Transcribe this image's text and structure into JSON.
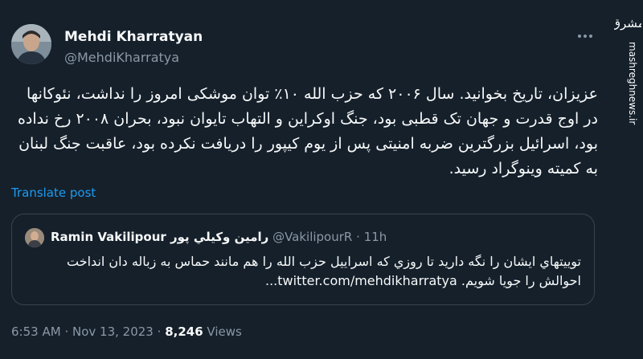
{
  "author": {
    "name": "Mehdi Kharratyan",
    "handle": "@MehdiKharratya"
  },
  "tweet": {
    "text": "عزیزان، تاریخ بخوانید. سال ۲۰۰۶ که حزب الله ۱۰٪ توان موشکی امروز را نداشت، نئوکانها در اوج قدرت و جهان تک قطبی بود، جنگ اوکراین و التهاب تایوان نبود، بحران ۲۰۰۸ رخ نداده بود، اسرائیل بزرگترین ضربه امنیتی پس از یوم کیپور را دریافت نکرده بود، عاقبت جنگ لبنان به کمیته وینوگراد رسید.",
    "translate_label": "Translate post"
  },
  "quote": {
    "name": "Ramin Vakilipour رامين وكيلي پور",
    "handle": "@VakilipourR",
    "separator": "·",
    "time": "11h",
    "text": "تويیتهاي ايشان را نگه داريد تا روزي كه اسراييل حزب الله را هم مانند حماس به زباله دان انداخت احوالش را جويا شويم. twitter.com/mehdikharratya..."
  },
  "meta": {
    "time": "6:53 AM",
    "dot1": "·",
    "date": "Nov 13, 2023",
    "dot2": "·",
    "views_count": "8,246",
    "views_label": "Views"
  },
  "watermark": {
    "site": "mashreghnews.ir",
    "logo_text": "مشرق"
  }
}
